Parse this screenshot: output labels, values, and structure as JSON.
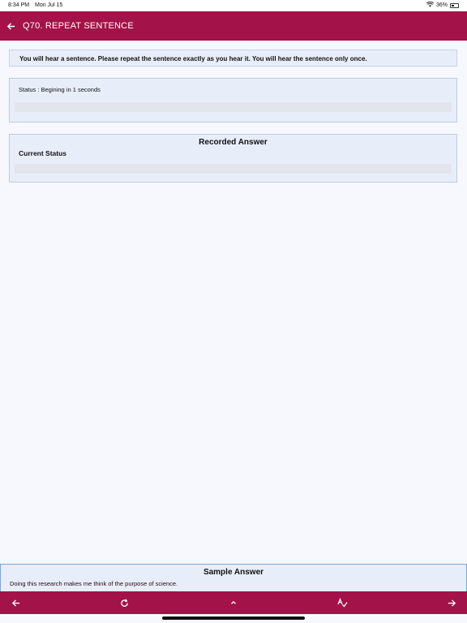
{
  "status_bar": {
    "time": "8:34 PM",
    "date": "Mon Jul 15",
    "battery": "36%"
  },
  "app_bar": {
    "title": "Q70. REPEAT SENTENCE",
    "back_icon": "arrow-left-icon",
    "color": "#a31248"
  },
  "instruction": "You will hear a sentence. Please repeat the sentence exactly as you hear it. You will hear the sentence only once.",
  "status_panel": {
    "status_text": "Status : Begining in 1 seconds"
  },
  "recorded_panel": {
    "title": "Recorded Answer",
    "current_status_label": "Current Status"
  },
  "sample_answer": {
    "title": "Sample Answer",
    "text": "Doing this research makes me think of the purpose of science."
  },
  "bottom_nav": {
    "icons": [
      "arrow-left-icon",
      "refresh-icon",
      "chevron-up-icon",
      "spellcheck-icon",
      "arrow-right-icon"
    ]
  }
}
